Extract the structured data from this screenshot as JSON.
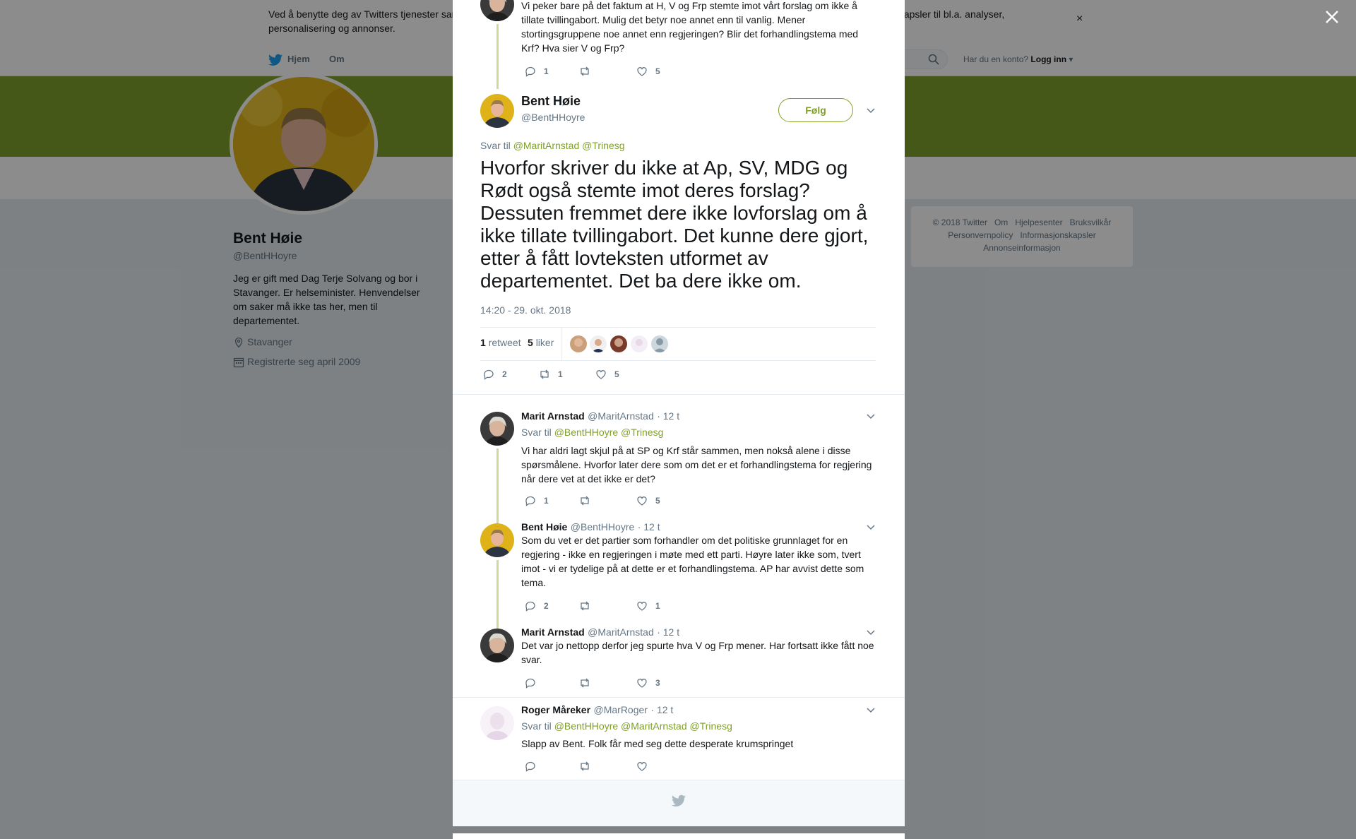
{
  "cookie_banner": {
    "text": "Ved å benytte deg av Twitters tjenester samtykker du i vår bruk av informasjonskapsler. Vi og våre partnere driver globalt og bruker informasjonskapsler til bl.a. analyser, personalisering og annonser.",
    "close": "×"
  },
  "nav": {
    "home": "Hjem",
    "about": "Om",
    "has_account": "Har du en konto?",
    "login": "Logg inn"
  },
  "profile": {
    "name": "Bent Høie",
    "handle": "@BentHHoyre",
    "bio": "Jeg er gift med Dag Terje Solvang og bor i Stavanger. Er helseminister. Henvendelser om saker må ikke tas her, men til departementet.",
    "location": "Stavanger",
    "joined": "Registrerte seg april 2009"
  },
  "footer": {
    "items": [
      "© 2018 Twitter",
      "Om",
      "Hjelpesenter",
      "Bruksvilkår",
      "Personvernpolicy",
      "Informasjonskapsler",
      "Annonseinformasjon"
    ]
  },
  "parent_tweet": {
    "text": "Vi peker bare på det faktum at H, V og Frp stemte imot vårt forslag om ikke å tillate tvillingabort. Mulig det betyr noe annet enn til vanlig. Mener stortingsgruppene noe annet enn regjeringen? Blir det forhandlingstema med Krf? Hva sier V og Frp?",
    "replies": "1",
    "likes": "5"
  },
  "main_tweet": {
    "name": "Bent Høie",
    "handle": "@BentHHoyre",
    "follow": "Følg",
    "reply_prefix": "Svar til",
    "mention1": "@MaritArnstad",
    "mention2": "@Trinesg",
    "text": "Hvorfor skriver du ikke at Ap, SV, MDG og Rødt også stemte imot deres forslag? Dessuten fremmet dere ikke lovforslag om å ikke tillate tvillingabort. Det kunne dere gjort, etter å fått lovteksten utformet av departementet. Det ba dere ikke om.",
    "date": "14:20 - 29. okt. 2018",
    "retweet_count": "1",
    "retweet_label": "retweet",
    "like_count": "5",
    "like_label": "liker",
    "replies": "2",
    "retweets": "1",
    "likes": "5"
  },
  "replies": [
    {
      "name": "Marit Arnstad",
      "handle": "@MaritArnstad",
      "time": "· 12 t",
      "reply_prefix": "Svar til",
      "mentions": "@BentHHoyre @Trinesg",
      "text": "Vi har aldri lagt skjul på at SP og Krf står sammen, men nokså alene i disse spørsmålene. Hvorfor later dere som om det er et forhandlingstema for regjering når dere vet at det ikke er det?",
      "replies": "1",
      "retweets": "",
      "likes": "5"
    },
    {
      "name": "Bent Høie",
      "handle": "@BentHHoyre",
      "time": "· 12 t",
      "text": "Som du vet er det partier som forhandler om det politiske grunnlaget for en regjering - ikke en regjeringen i møte med ett parti. Høyre later ikke som, tvert imot - vi er tydelige på at dette er et forhandlingstema. AP har avvist dette som tema.",
      "replies": "2",
      "retweets": "",
      "likes": "1"
    },
    {
      "name": "Marit Arnstad",
      "handle": "@MaritArnstad",
      "time": "· 12 t",
      "text": "Det var jo nettopp derfor jeg spurte hva V og Frp mener. Har fortsatt ikke fått noe svar.",
      "replies": "",
      "retweets": "",
      "likes": "3"
    },
    {
      "name": "Roger Måreker",
      "handle": "@MarRoger",
      "time": "· 12 t",
      "reply_prefix": "Svar til",
      "mentions": "@BentHHoyre @MaritArnstad @Trinesg",
      "text": "Slapp av Bent. Folk får med seg dette desperate krumspringet",
      "replies": "",
      "retweets": "",
      "likes": ""
    }
  ],
  "colors": {
    "accent": "#80A02A",
    "banner": "#80A02A",
    "thread_line": "#D1D99A"
  },
  "icons": [
    "twitter-bird-icon",
    "search-icon",
    "location-icon",
    "calendar-icon",
    "reply-icon",
    "retweet-icon",
    "like-icon",
    "chevron-down-icon",
    "close-icon"
  ]
}
